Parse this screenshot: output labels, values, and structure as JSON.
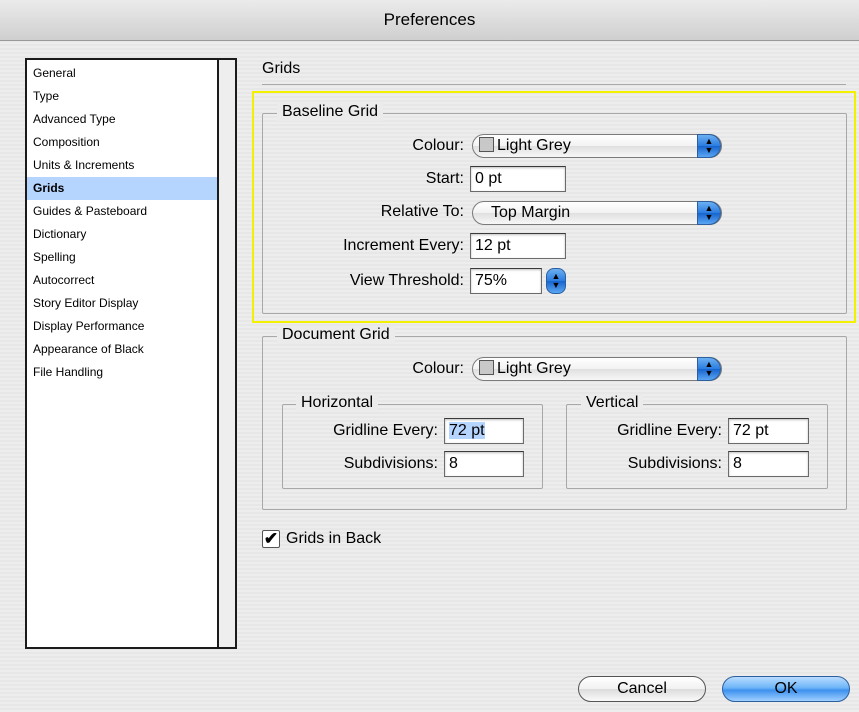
{
  "window": {
    "title": "Preferences"
  },
  "sidebar": {
    "items": [
      {
        "label": "General"
      },
      {
        "label": "Type"
      },
      {
        "label": "Advanced Type"
      },
      {
        "label": "Composition"
      },
      {
        "label": "Units & Increments"
      },
      {
        "label": "Grids",
        "selected": true
      },
      {
        "label": "Guides & Pasteboard"
      },
      {
        "label": "Dictionary"
      },
      {
        "label": "Spelling"
      },
      {
        "label": "Autocorrect"
      },
      {
        "label": "Story Editor Display"
      },
      {
        "label": "Display Performance"
      },
      {
        "label": "Appearance of Black"
      },
      {
        "label": "File Handling"
      }
    ]
  },
  "main": {
    "section_title": "Grids",
    "baseline_grid": {
      "title": "Baseline Grid",
      "colour_label": "Colour:",
      "colour_value": "Light Grey",
      "start_label": "Start:",
      "start_value": "0 pt",
      "relative_to_label": "Relative To:",
      "relative_to_value": "Top Margin",
      "increment_label": "Increment Every:",
      "increment_value": "12 pt",
      "threshold_label": "View Threshold:",
      "threshold_value": "75%"
    },
    "document_grid": {
      "title": "Document Grid",
      "colour_label": "Colour:",
      "colour_value": "Light Grey",
      "horizontal": {
        "title": "Horizontal",
        "gridline_label": "Gridline Every:",
        "gridline_value": "72 pt",
        "subdivisions_label": "Subdivisions:",
        "subdivisions_value": "8"
      },
      "vertical": {
        "title": "Vertical",
        "gridline_label": "Gridline Every:",
        "gridline_value": "72 pt",
        "subdivisions_label": "Subdivisions:",
        "subdivisions_value": "8"
      }
    },
    "grids_in_back": {
      "label": "Grids in Back",
      "checked": true
    }
  },
  "footer": {
    "cancel_label": "Cancel",
    "ok_label": "OK"
  },
  "colors": {
    "selection": "#b5d5ff",
    "highlight_frame": "#f3f000",
    "accent_blue": "#3d90ee"
  }
}
